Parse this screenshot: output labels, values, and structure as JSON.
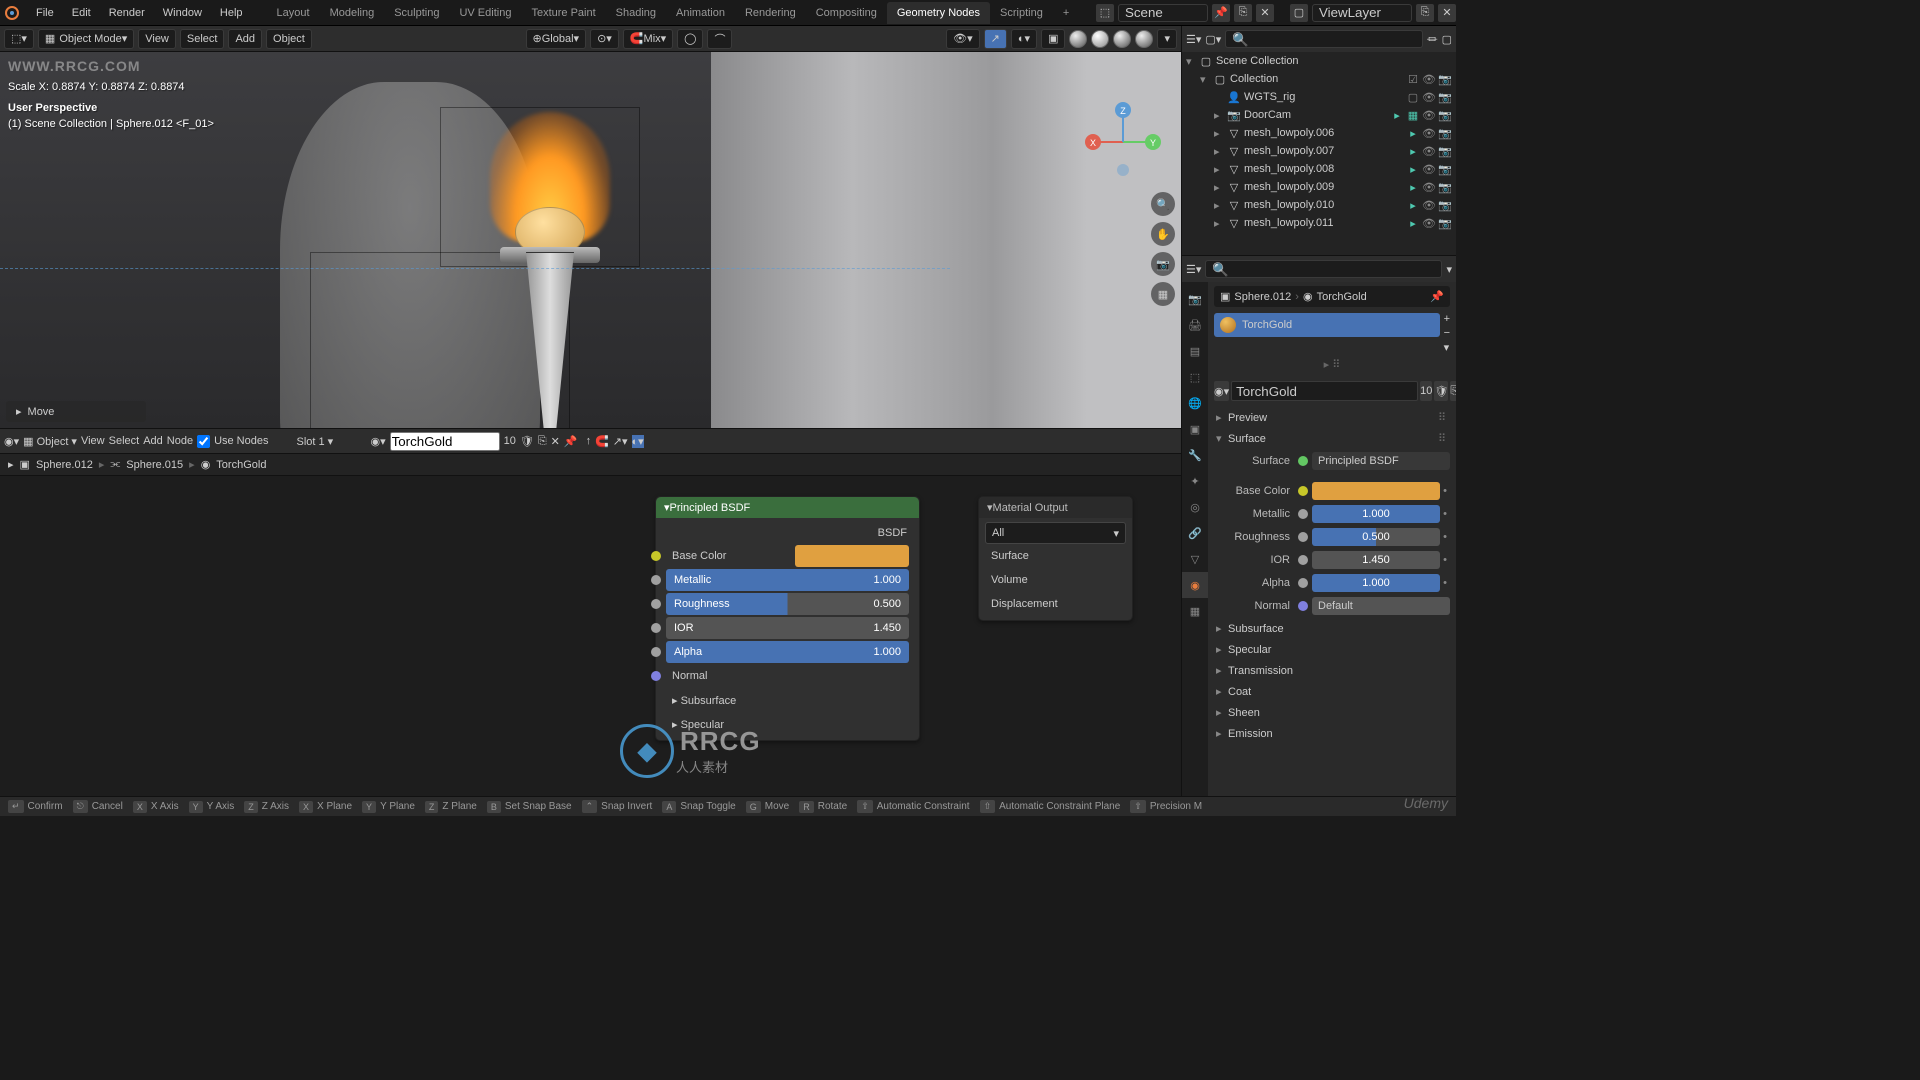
{
  "topbar": {
    "menus": [
      "File",
      "Edit",
      "Render",
      "Window",
      "Help"
    ],
    "workspaces": [
      "Layout",
      "Modeling",
      "Sculpting",
      "UV Editing",
      "Texture Paint",
      "Shading",
      "Animation",
      "Rendering",
      "Compositing",
      "Geometry Nodes",
      "Scripting"
    ],
    "active_workspace": "Geometry Nodes",
    "scene": "Scene",
    "viewlayer": "ViewLayer"
  },
  "viewport_header": {
    "mode": "Object Mode",
    "menus": [
      "View",
      "Select",
      "Add",
      "Object"
    ],
    "orientation": "Global",
    "snap": "Mix"
  },
  "viewport": {
    "transform_info": "Scale X: 0.8874   Y: 0.8874   Z: 0.8874",
    "perspective": "User Perspective",
    "context": "(1) Scene Collection | Sphere.012 <F_01>",
    "last_op": "Move"
  },
  "outliner": {
    "root": "Scene Collection",
    "collection": "Collection",
    "items": [
      {
        "name": "WGTS_rig",
        "type": "armature"
      },
      {
        "name": "DoorCam",
        "type": "camera"
      },
      {
        "name": "mesh_lowpoly.006",
        "type": "mesh"
      },
      {
        "name": "mesh_lowpoly.007",
        "type": "mesh"
      },
      {
        "name": "mesh_lowpoly.008",
        "type": "mesh"
      },
      {
        "name": "mesh_lowpoly.009",
        "type": "mesh"
      },
      {
        "name": "mesh_lowpoly.010",
        "type": "mesh"
      },
      {
        "name": "mesh_lowpoly.011",
        "type": "mesh"
      }
    ]
  },
  "props_header_search": "",
  "properties": {
    "breadcrumb_obj": "Sphere.012",
    "breadcrumb_mat": "TorchGold",
    "slot_material": "TorchGold",
    "material_name": "TorchGold",
    "users": "10",
    "panels": {
      "preview": "Preview",
      "surface": "Surface",
      "subsurface": "Subsurface",
      "specular": "Specular",
      "transmission": "Transmission",
      "coat": "Coat",
      "sheen": "Sheen",
      "emission": "Emission"
    },
    "surface_type": "Principled BSDF",
    "base_color_label": "Base Color",
    "metallic": {
      "label": "Metallic",
      "value": "1.000"
    },
    "roughness": {
      "label": "Roughness",
      "value": "0.500"
    },
    "ior": {
      "label": "IOR",
      "value": "1.450"
    },
    "alpha": {
      "label": "Alpha",
      "value": "1.000"
    },
    "normal": {
      "label": "Normal",
      "value": "Default"
    }
  },
  "node_editor": {
    "header": {
      "mode": "Object",
      "menus": [
        "View",
        "Select",
        "Add",
        "Node"
      ],
      "use_nodes": "Use Nodes",
      "slot": "Slot 1",
      "material": "TorchGold",
      "users": "10"
    },
    "breadcrumb": [
      "Sphere.012",
      "Sphere.015",
      "TorchGold"
    ],
    "principled": {
      "title": "Principled BSDF",
      "bsdf_out": "BSDF",
      "base_color": "Base Color",
      "metallic": {
        "label": "Metallic",
        "value": "1.000"
      },
      "roughness": {
        "label": "Roughness",
        "value": "0.500"
      },
      "ior": {
        "label": "IOR",
        "value": "1.450"
      },
      "alpha": {
        "label": "Alpha",
        "value": "1.000"
      },
      "normal": "Normal",
      "subsurface": "Subsurface",
      "specular": "Specular"
    },
    "output": {
      "title": "Material Output",
      "target": "All",
      "surface": "Surface",
      "volume": "Volume",
      "displacement": "Displacement"
    }
  },
  "statusbar": {
    "items": [
      {
        "key": "↵",
        "label": "Confirm"
      },
      {
        "key": "⎋",
        "label": "Cancel"
      },
      {
        "key": "X",
        "label": "X Axis"
      },
      {
        "key": "Y",
        "label": "Y Axis"
      },
      {
        "key": "Z",
        "label": "Z Axis"
      },
      {
        "key": "X",
        "label": "X Plane"
      },
      {
        "key": "Y",
        "label": "Y Plane"
      },
      {
        "key": "Z",
        "label": "Z Plane"
      },
      {
        "key": "B",
        "label": "Set Snap Base"
      },
      {
        "key": "⌃",
        "label": "Snap Invert"
      },
      {
        "key": "A",
        "label": "Snap Toggle"
      },
      {
        "key": "G",
        "label": "Move"
      },
      {
        "key": "R",
        "label": "Rotate"
      },
      {
        "key": "⇧",
        "label": "Automatic Constraint"
      },
      {
        "key": "⇧",
        "label": "Automatic Constraint Plane"
      },
      {
        "key": "⇧",
        "label": "Precision M"
      }
    ]
  },
  "watermark": {
    "corner": "WWW.RRCG.COM",
    "center": "RRCG",
    "center_sub": "人人素材",
    "bottom": "Udemy"
  }
}
